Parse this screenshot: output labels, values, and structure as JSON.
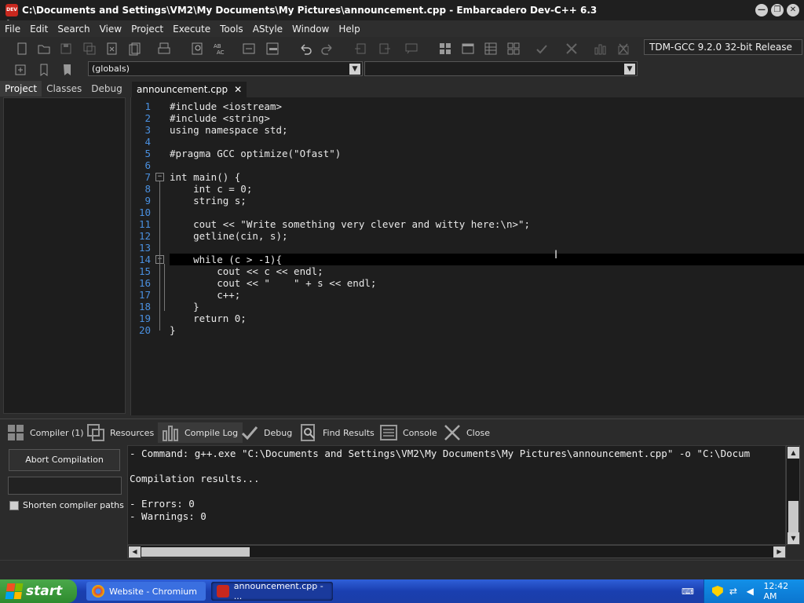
{
  "window": {
    "title": "C:\\Documents and Settings\\VM2\\My Documents\\My Pictures\\announcement.cpp - Embarcadero Dev-C++ 6.3",
    "app_icon_label": "DEV C++",
    "controls": {
      "minimize": "—",
      "restore": "❐",
      "close": "✕"
    }
  },
  "menu": {
    "items": [
      "File",
      "Edit",
      "Search",
      "View",
      "Project",
      "Execute",
      "Tools",
      "AStyle",
      "Window",
      "Help"
    ]
  },
  "toolbar": {
    "compiler": "TDM-GCC 9.2.0 32-bit Release",
    "scope_combo": "(globals)",
    "function_combo": ""
  },
  "left_panel": {
    "tabs": [
      "Project",
      "Classes",
      "Debug"
    ],
    "active_tab": "Project"
  },
  "editor": {
    "file_tab": "announcement.cpp",
    "close_glyph": "✕",
    "cursor_glyph": "I",
    "lines": [
      {
        "n": "1",
        "text": "#include <iostream>"
      },
      {
        "n": "2",
        "text": "#include <string>"
      },
      {
        "n": "3",
        "text": "using namespace std;"
      },
      {
        "n": "4",
        "text": ""
      },
      {
        "n": "5",
        "text": "#pragma GCC optimize(\"Ofast\")"
      },
      {
        "n": "6",
        "text": ""
      },
      {
        "n": "7",
        "text": "int main() {"
      },
      {
        "n": "8",
        "text": "    int c = 0;"
      },
      {
        "n": "9",
        "text": "    string s;"
      },
      {
        "n": "10",
        "text": ""
      },
      {
        "n": "11",
        "text": "    cout << \"Write something very clever and witty here:\\n>\";"
      },
      {
        "n": "12",
        "text": "    getline(cin, s);"
      },
      {
        "n": "13",
        "text": ""
      },
      {
        "n": "14",
        "text": "    while (c > -1){"
      },
      {
        "n": "15",
        "text": "        cout << c << endl;"
      },
      {
        "n": "16",
        "text": "        cout << \"    \" + s << endl;"
      },
      {
        "n": "17",
        "text": "        c++;"
      },
      {
        "n": "18",
        "text": "    }"
      },
      {
        "n": "19",
        "text": "    return 0;"
      },
      {
        "n": "20",
        "text": "}"
      }
    ]
  },
  "bottom_tabs": {
    "compiler": "Compiler (1)",
    "resources": "Resources",
    "compile_log": "Compile Log",
    "debug": "Debug",
    "find_results": "Find Results",
    "console": "Console",
    "close": "Close"
  },
  "compile_panel": {
    "abort_label": "Abort Compilation",
    "progress": 0,
    "shorten_paths_label": "Shorten compiler paths",
    "shorten_paths_checked": false,
    "log": [
      "- Command: g++.exe \"C:\\Documents and Settings\\VM2\\My Documents\\My Pictures\\announcement.cpp\" -o \"C:\\Docum",
      "",
      "Compilation results...",
      "",
      "- Errors: 0",
      "- Warnings: 0"
    ]
  },
  "taskbar": {
    "start_label": "start",
    "tasks": [
      "Website - Chromium",
      "announcement.cpp - ..."
    ],
    "clock": "12:42 AM"
  },
  "colors": {
    "keyword": "#4a90e0",
    "string": "#e08a2a",
    "preprocessor": "#9a9a9a",
    "accent": "#4a90e0"
  }
}
